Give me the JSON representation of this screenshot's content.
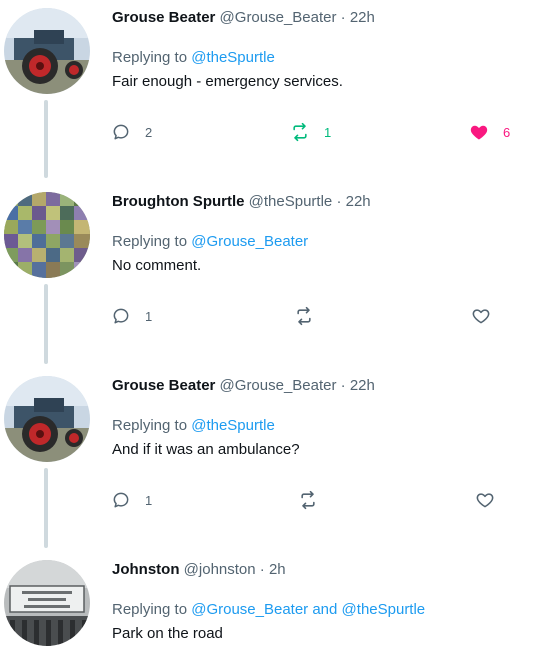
{
  "tweets": [
    {
      "name": "Grouse Beater",
      "handle": "@Grouse_Beater",
      "time": "22h",
      "replying_prefix": "Replying to ",
      "replying_to": "@theSpurtle",
      "replying_conj": "",
      "replying_to_2": "",
      "text": "Fair enough - emergency services.",
      "replies": "2",
      "retweets": "1",
      "likes": "6",
      "retweeted": true,
      "liked": true,
      "avatar": "tractor"
    },
    {
      "name": "Broughton Spurtle",
      "handle": "@theSpurtle",
      "time": "22h",
      "replying_prefix": "Replying to ",
      "replying_to": "@Grouse_Beater",
      "replying_conj": "",
      "replying_to_2": "",
      "text": "No comment.",
      "replies": "1",
      "retweets": "",
      "likes": "",
      "retweeted": false,
      "liked": false,
      "avatar": "mosaic"
    },
    {
      "name": "Grouse Beater",
      "handle": "@Grouse_Beater",
      "time": "22h",
      "replying_prefix": "Replying to ",
      "replying_to": "@theSpurtle",
      "replying_conj": "",
      "replying_to_2": "",
      "text": "And if it was an ambulance?",
      "replies": "1",
      "retweets": "",
      "likes": "",
      "retweeted": false,
      "liked": false,
      "avatar": "tractor"
    },
    {
      "name": "Johnston",
      "handle": "@johnston",
      "time": "2h",
      "replying_prefix": "Replying to ",
      "replying_to": "@Grouse_Beater",
      "replying_conj": " and ",
      "replying_to_2": "@theSpurtle",
      "text": "Park on the road",
      "replies": "",
      "retweets": "",
      "likes": "",
      "retweeted": false,
      "liked": false,
      "avatar": "sign"
    }
  ],
  "separator": "·",
  "colors": {
    "text": "#0f1419",
    "secondary": "#536471",
    "link": "#1d9bf0",
    "retweet_active": "#00ba7c",
    "like_active": "#f91880",
    "thread_line": "#cfd9de"
  },
  "icons": {
    "reply": "reply-icon",
    "retweet": "retweet-icon",
    "like": "heart-icon"
  }
}
